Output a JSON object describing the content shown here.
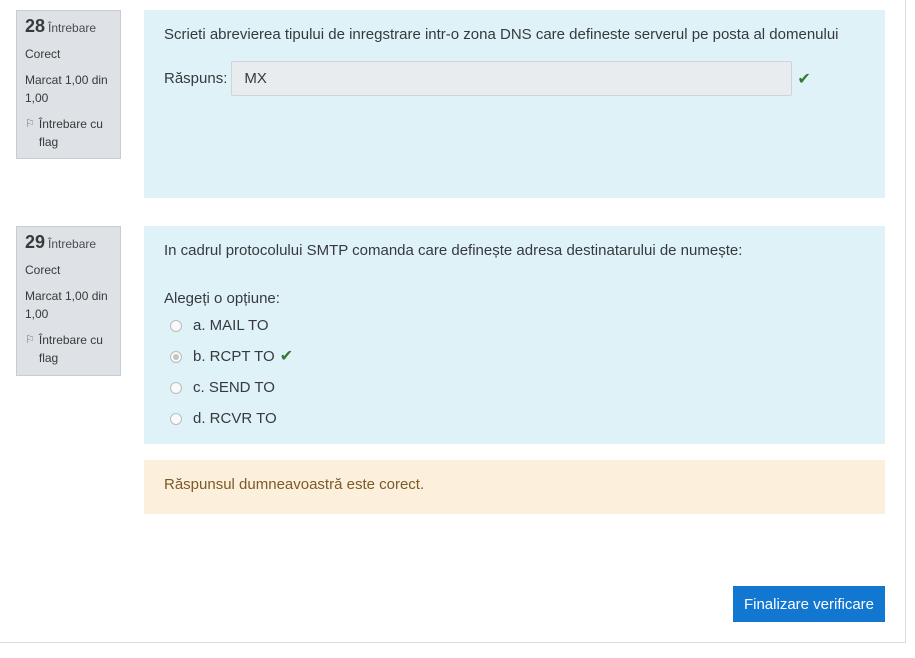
{
  "questions": [
    {
      "number": "28",
      "word": "Întrebare",
      "status": "Corect",
      "mark": "Marcat 1,00 din 1,00",
      "flag_label": "Întrebare cu flag",
      "text": "Scrieti abrevierea tipului de inregstrare intr-o zona DNS care defineste serverul pe posta al domenului",
      "answer_label": "Răspuns:",
      "answer_value": "MX"
    },
    {
      "number": "29",
      "word": "Întrebare",
      "status": "Corect",
      "mark": "Marcat 1,00 din 1,00",
      "flag_label": "Întrebare cu flag",
      "text": "In cadrul protocolului SMTP comanda care definește adresa destinatarului de numește:",
      "prompt": "Alegeți o opțiune:",
      "options": [
        {
          "label": "a. MAIL TO",
          "selected": false
        },
        {
          "label": "b. RCPT TO",
          "selected": true,
          "correct": true
        },
        {
          "label": "c. SEND TO",
          "selected": false
        },
        {
          "label": "d. RCVR TO",
          "selected": false
        }
      ],
      "feedback": "Răspunsul dumneavoastră este corect."
    }
  ],
  "finish_button": "Finalizare verificare",
  "colors": {
    "info_bg": "#dee2e6",
    "content_bg": "#def2f8",
    "feedback_bg": "#fcefdc",
    "button_bg": "#1177d1",
    "check": "#357a32"
  }
}
